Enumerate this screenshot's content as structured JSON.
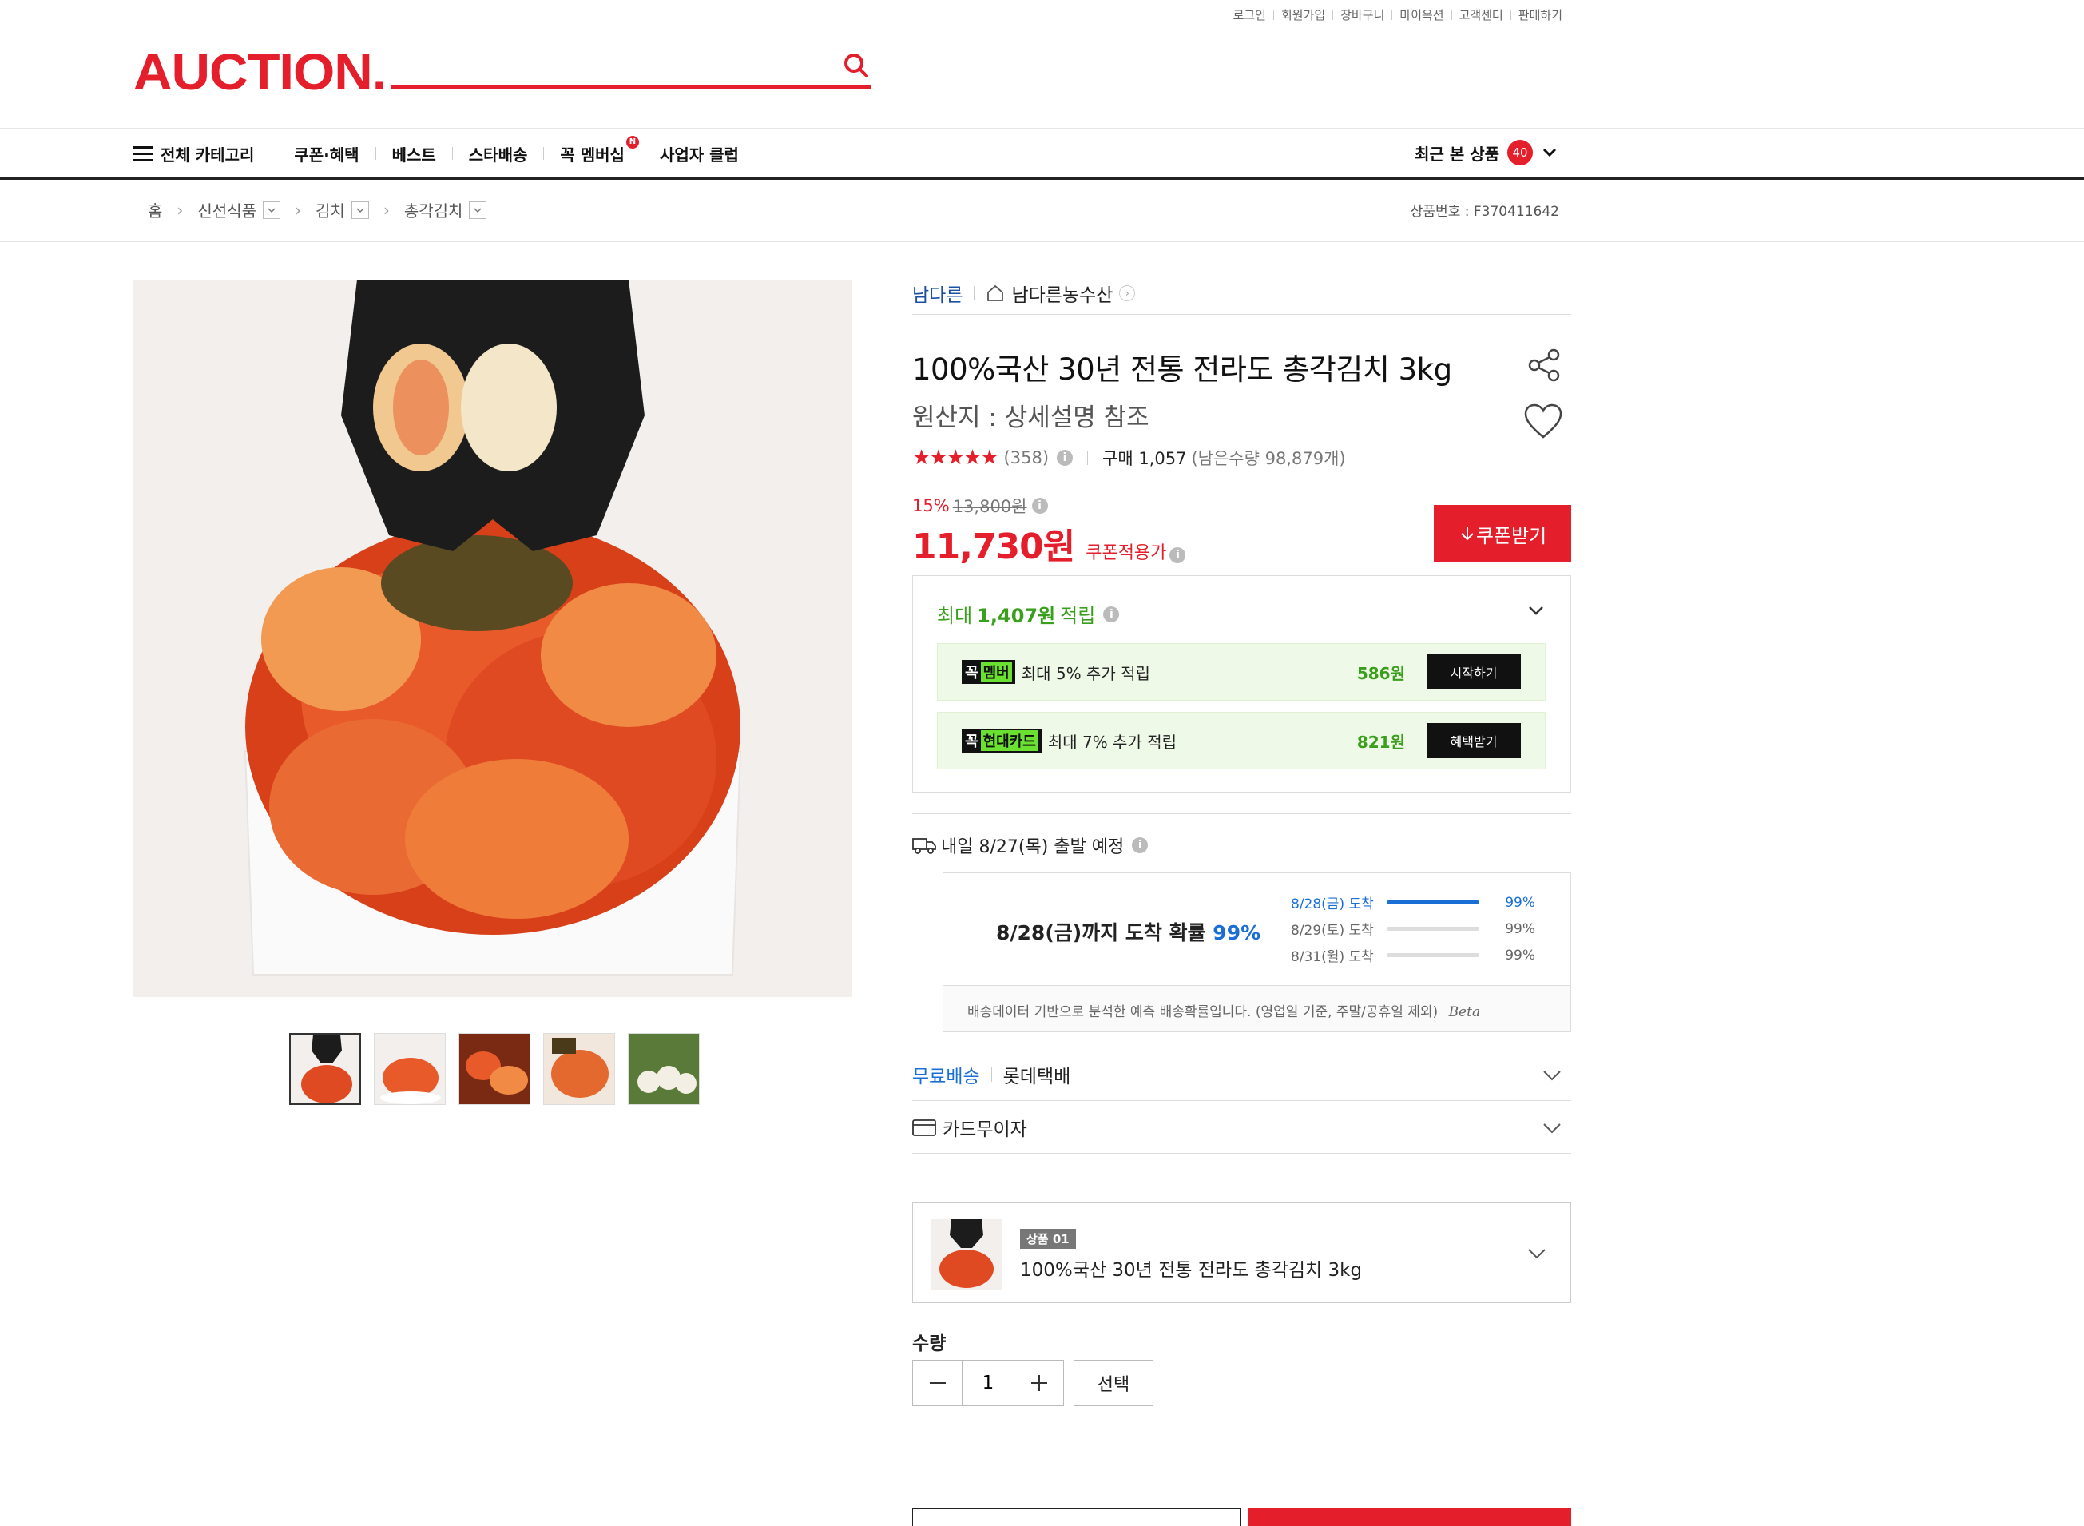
{
  "util_links": [
    "로그인",
    "회원가입",
    "장바구니",
    "마이옥션",
    "고객센터",
    "판매하기"
  ],
  "logo": "AUCTION.",
  "search": {
    "value": "",
    "placeholder": ""
  },
  "nav": {
    "all_categories": "전체 카테고리",
    "items": [
      "쿠폰·혜택",
      "베스트",
      "스타배송",
      "꼭 멤버십",
      "사업자 클럽"
    ],
    "badge": "N",
    "recent_label": "최근 본 상품",
    "recent_count": "40"
  },
  "breadcrumb": {
    "home": "홈",
    "items": [
      "신선식품",
      "김치",
      "총각김치"
    ],
    "product_no": "상품번호 : F370411642"
  },
  "seller": {
    "brand": "남다른",
    "store": "남다른농수산"
  },
  "product": {
    "title": "100%국산 30년 전통 전라도 총각김치 3kg",
    "origin": "원산지 : 상세설명 참조",
    "stars": "★★★★★",
    "review_count": "(358)",
    "purchases": "구매 1,057",
    "remaining": "(남은수량 98,879개)",
    "discount_pct": "15%",
    "original_price": "13,800원",
    "price": "11,730원",
    "price_note": "쿠폰적용가",
    "coupon_btn": "쿠폰받기"
  },
  "points": {
    "prefix": "최대",
    "amount": "1,407원",
    "suffix": "적립",
    "rows": [
      {
        "tag1": "꼭",
        "tag2": "멤버",
        "desc": "최대 5% 추가 적립",
        "amount": "586원",
        "btn": "시작하기"
      },
      {
        "tag1": "꼭",
        "tag2": "현대카드",
        "desc": "최대 7% 추가 적립",
        "amount": "821원",
        "btn": "혜택받기"
      }
    ]
  },
  "shipping": {
    "head": "내일 8/27(목) 출발 예정",
    "arrival_main": "8/28(금)까지 도착 확률",
    "arrival_pct": "99%",
    "rows": [
      {
        "label": "8/28(금) 도착",
        "value": "99%",
        "fill": 1.0
      },
      {
        "label": "8/29(토) 도착",
        "value": "99%",
        "fill": 0
      },
      {
        "label": "8/31(월) 도착",
        "value": "99%",
        "fill": 0
      }
    ],
    "foot": "배송데이터 기반으로 분석한 예측 배송확률입니다. (영업일 기준, 주말/공휴일 제외)",
    "beta": "Beta"
  },
  "delivery": {
    "free": "무료배송",
    "carrier": "롯데택배"
  },
  "card": {
    "label": "카드무이자"
  },
  "selected": {
    "tag": "상품 01",
    "name": "100%국산 30년 전통 전라도 총각김치 3kg"
  },
  "quantity": {
    "label": "수량",
    "value": "1",
    "select_btn": "선택"
  },
  "colors": {
    "brand": "#e41e2b",
    "accent_blue": "#1a6fd6",
    "accent_green": "#3a9f1c"
  }
}
